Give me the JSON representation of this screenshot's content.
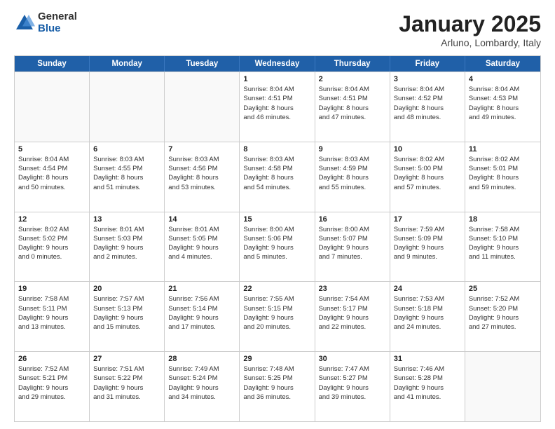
{
  "logo": {
    "general": "General",
    "blue": "Blue"
  },
  "title": "January 2025",
  "subtitle": "Arluno, Lombardy, Italy",
  "weekdays": [
    "Sunday",
    "Monday",
    "Tuesday",
    "Wednesday",
    "Thursday",
    "Friday",
    "Saturday"
  ],
  "rows": [
    [
      {
        "day": "",
        "info": ""
      },
      {
        "day": "",
        "info": ""
      },
      {
        "day": "",
        "info": ""
      },
      {
        "day": "1",
        "info": "Sunrise: 8:04 AM\nSunset: 4:51 PM\nDaylight: 8 hours\nand 46 minutes."
      },
      {
        "day": "2",
        "info": "Sunrise: 8:04 AM\nSunset: 4:51 PM\nDaylight: 8 hours\nand 47 minutes."
      },
      {
        "day": "3",
        "info": "Sunrise: 8:04 AM\nSunset: 4:52 PM\nDaylight: 8 hours\nand 48 minutes."
      },
      {
        "day": "4",
        "info": "Sunrise: 8:04 AM\nSunset: 4:53 PM\nDaylight: 8 hours\nand 49 minutes."
      }
    ],
    [
      {
        "day": "5",
        "info": "Sunrise: 8:04 AM\nSunset: 4:54 PM\nDaylight: 8 hours\nand 50 minutes."
      },
      {
        "day": "6",
        "info": "Sunrise: 8:03 AM\nSunset: 4:55 PM\nDaylight: 8 hours\nand 51 minutes."
      },
      {
        "day": "7",
        "info": "Sunrise: 8:03 AM\nSunset: 4:56 PM\nDaylight: 8 hours\nand 53 minutes."
      },
      {
        "day": "8",
        "info": "Sunrise: 8:03 AM\nSunset: 4:58 PM\nDaylight: 8 hours\nand 54 minutes."
      },
      {
        "day": "9",
        "info": "Sunrise: 8:03 AM\nSunset: 4:59 PM\nDaylight: 8 hours\nand 55 minutes."
      },
      {
        "day": "10",
        "info": "Sunrise: 8:02 AM\nSunset: 5:00 PM\nDaylight: 8 hours\nand 57 minutes."
      },
      {
        "day": "11",
        "info": "Sunrise: 8:02 AM\nSunset: 5:01 PM\nDaylight: 8 hours\nand 59 minutes."
      }
    ],
    [
      {
        "day": "12",
        "info": "Sunrise: 8:02 AM\nSunset: 5:02 PM\nDaylight: 9 hours\nand 0 minutes."
      },
      {
        "day": "13",
        "info": "Sunrise: 8:01 AM\nSunset: 5:03 PM\nDaylight: 9 hours\nand 2 minutes."
      },
      {
        "day": "14",
        "info": "Sunrise: 8:01 AM\nSunset: 5:05 PM\nDaylight: 9 hours\nand 4 minutes."
      },
      {
        "day": "15",
        "info": "Sunrise: 8:00 AM\nSunset: 5:06 PM\nDaylight: 9 hours\nand 5 minutes."
      },
      {
        "day": "16",
        "info": "Sunrise: 8:00 AM\nSunset: 5:07 PM\nDaylight: 9 hours\nand 7 minutes."
      },
      {
        "day": "17",
        "info": "Sunrise: 7:59 AM\nSunset: 5:09 PM\nDaylight: 9 hours\nand 9 minutes."
      },
      {
        "day": "18",
        "info": "Sunrise: 7:58 AM\nSunset: 5:10 PM\nDaylight: 9 hours\nand 11 minutes."
      }
    ],
    [
      {
        "day": "19",
        "info": "Sunrise: 7:58 AM\nSunset: 5:11 PM\nDaylight: 9 hours\nand 13 minutes."
      },
      {
        "day": "20",
        "info": "Sunrise: 7:57 AM\nSunset: 5:13 PM\nDaylight: 9 hours\nand 15 minutes."
      },
      {
        "day": "21",
        "info": "Sunrise: 7:56 AM\nSunset: 5:14 PM\nDaylight: 9 hours\nand 17 minutes."
      },
      {
        "day": "22",
        "info": "Sunrise: 7:55 AM\nSunset: 5:15 PM\nDaylight: 9 hours\nand 20 minutes."
      },
      {
        "day": "23",
        "info": "Sunrise: 7:54 AM\nSunset: 5:17 PM\nDaylight: 9 hours\nand 22 minutes."
      },
      {
        "day": "24",
        "info": "Sunrise: 7:53 AM\nSunset: 5:18 PM\nDaylight: 9 hours\nand 24 minutes."
      },
      {
        "day": "25",
        "info": "Sunrise: 7:52 AM\nSunset: 5:20 PM\nDaylight: 9 hours\nand 27 minutes."
      }
    ],
    [
      {
        "day": "26",
        "info": "Sunrise: 7:52 AM\nSunset: 5:21 PM\nDaylight: 9 hours\nand 29 minutes."
      },
      {
        "day": "27",
        "info": "Sunrise: 7:51 AM\nSunset: 5:22 PM\nDaylight: 9 hours\nand 31 minutes."
      },
      {
        "day": "28",
        "info": "Sunrise: 7:49 AM\nSunset: 5:24 PM\nDaylight: 9 hours\nand 34 minutes."
      },
      {
        "day": "29",
        "info": "Sunrise: 7:48 AM\nSunset: 5:25 PM\nDaylight: 9 hours\nand 36 minutes."
      },
      {
        "day": "30",
        "info": "Sunrise: 7:47 AM\nSunset: 5:27 PM\nDaylight: 9 hours\nand 39 minutes."
      },
      {
        "day": "31",
        "info": "Sunrise: 7:46 AM\nSunset: 5:28 PM\nDaylight: 9 hours\nand 41 minutes."
      },
      {
        "day": "",
        "info": ""
      }
    ]
  ]
}
